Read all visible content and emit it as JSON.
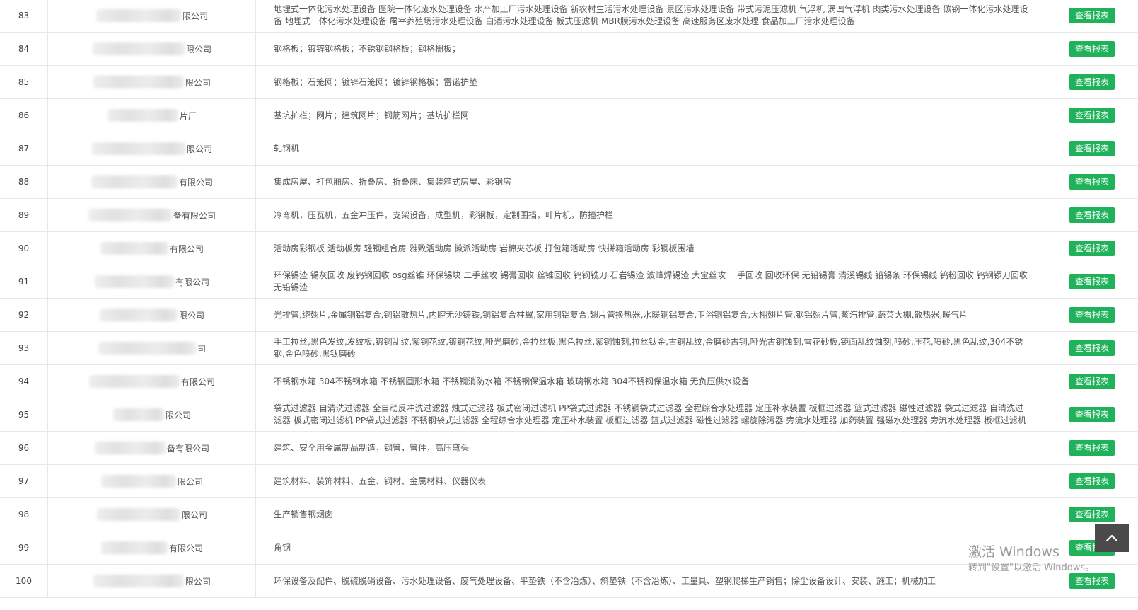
{
  "button_label": "查看报表",
  "rows": [
    {
      "no": "83",
      "name_suffix": "限公司",
      "blur_width": 120,
      "desc": "地埋式一体化污水处理设备 医院一体化废水处理设备 水产加工厂污水处理设备 新农村生活污水处理设备 景区污水处理设备 带式污泥压滤机 气浮机 涡凹气浮机 肉类污水处理设备 碳钢一体化污水处理设备 地埋式一体化污水处理设备 屠宰养殖场污水处理设备 白酒污水处理设备 板式压滤机 MBR膜污水处理设备 高速服务区废水处理 食品加工厂污水处理设备"
    },
    {
      "no": "84",
      "name_suffix": "限公司",
      "blur_width": 130,
      "desc": "钢格板；镀锌钢格板；不锈钢钢格板；钢格栅板；"
    },
    {
      "no": "85",
      "name_suffix": "限公司",
      "blur_width": 128,
      "desc": "钢格板；石笼网；镀锌石笼网；镀锌钢格板；雷诺护垫"
    },
    {
      "no": "86",
      "name_suffix": "片厂",
      "blur_width": 100,
      "desc": "基坑护栏；网片；建筑网片；钢筋网片；基坑护栏网"
    },
    {
      "no": "87",
      "name_suffix": "限公司",
      "blur_width": 132,
      "desc": "轧钢机"
    },
    {
      "no": "88",
      "name_suffix": "有限公司",
      "blur_width": 122,
      "desc": "集成房屋、打包厢房、折叠房、折叠床、集装箱式房屋、彩钢房"
    },
    {
      "no": "89",
      "name_suffix": "备有限公司",
      "blur_width": 118,
      "desc": "冷弯机，压瓦机，五金冲压件，支架设备，成型机，彩钢板，定制围挡，叶片机，防撞护栏"
    },
    {
      "no": "90",
      "name_suffix": "有限公司",
      "blur_width": 96,
      "desc": "活动房彩钢板 活动板房 轻钢组合房 雅致活动房 徽派活动房 岩棉夹芯板 打包箱活动房 快拼箱活动房 彩钢板围墙"
    },
    {
      "no": "91",
      "name_suffix": "有限公司",
      "blur_width": 112,
      "desc": "环保锡渣 锡灰回收 废钨钢回收 osg丝锥 环保锡块 二手丝攻 锡膏回收 丝锥回收 钨钢铣刀 石岩锡渣 波峰焊锡渣 大宝丝攻 一手回收 回收环保 无铅锡膏 清溪锡线 铅锡条 环保锡线 钨粉回收 钨钢锣刀回收 无铅锡渣"
    },
    {
      "no": "92",
      "name_suffix": "限公司",
      "blur_width": 110,
      "desc": "光排管,绕翅片,金属铜铝复合,铜铝散热片,内腔无沙铸铁,铜铝复合柱翼,家用铜铝复合,翅片管换热器,水暖铜铝复合,卫浴铜铝复合,大棚翅片管,钢铝翅片管,蒸汽排管,蔬菜大棚,散热器,暖气片"
    },
    {
      "no": "93",
      "name_suffix": "司",
      "blur_width": 138,
      "desc": "手工拉丝,黑色发纹,发纹板,镀铜乱纹,紫铜花纹,镀铜花纹,哑光磨砂,金拉丝板,黑色拉丝,紫铜蚀刻,拉丝钛金,古铜乱纹,金磨砂古铜,哑光古铜蚀刻,雪花砂板,镜面乱纹蚀刻,喷砂,压花,喷砂,黑色乱纹,304不锈钢,金色喷砂,黑钛磨砂"
    },
    {
      "no": "94",
      "name_suffix": "有限公司",
      "blur_width": 128,
      "desc": "不锈钢水箱 304不锈钢水箱 不锈钢圆形水箱 不锈钢消防水箱 不锈钢保温水箱 玻璃钢水箱 304不锈钢保温水箱 无负压供水设备"
    },
    {
      "no": "95",
      "name_suffix": "限公司",
      "blur_width": 72,
      "desc": "袋式过滤器 自清洗过滤器 全自动反冲洗过滤器 烛式过滤器 板式密闭过滤机 PP袋式过滤器 不锈钢袋式过滤器 全程综合水处理器 定压补水装置 板框过滤器 篮式过滤器 磁性过滤器 袋式过滤器 自清洗过滤器 板式密闭过滤机 PP袋式过滤器 不锈钢袋式过滤器 全程综合水处理器 定压补水装置 板框过滤器 篮式过滤器 磁性过滤器 螺旋除污器 旁流水处理器 加药装置 强磁水处理器 旁流水处理器 板框过滤机"
    },
    {
      "no": "96",
      "name_suffix": "备有限公司",
      "blur_width": 100,
      "desc": "建筑、安全用金属制品制造，钢管，管件，高压弯头"
    },
    {
      "no": "97",
      "name_suffix": "限公司",
      "blur_width": 106,
      "desc": "建筑材料、装饰材料、五金、钢材、金属材料、仪器仪表"
    },
    {
      "no": "98",
      "name_suffix": "限公司",
      "blur_width": 118,
      "desc": "生产销售钢烟囱"
    },
    {
      "no": "99",
      "name_suffix": "有限公司",
      "blur_width": 94,
      "desc": "角钢"
    },
    {
      "no": "100",
      "name_suffix": "限公司",
      "blur_width": 128,
      "desc": "环保设备及配件、脱硫脱硝设备、污水处理设备、废气处理设备、平垫铁（不含冶炼）、斜垫铁（不含冶炼）、工量具、塑钢爬梯生产销售；除尘设备设计、安装、施工；机械加工"
    }
  ],
  "watermark": {
    "line1": "激活 Windows",
    "line2": "转到\"设置\"以激活 Windows。"
  },
  "icons": {
    "scroll_top": "chevron-up-icon"
  },
  "colors": {
    "button_bg": "#1fb25a",
    "scroll_top_bg": "#4a4a4a"
  }
}
